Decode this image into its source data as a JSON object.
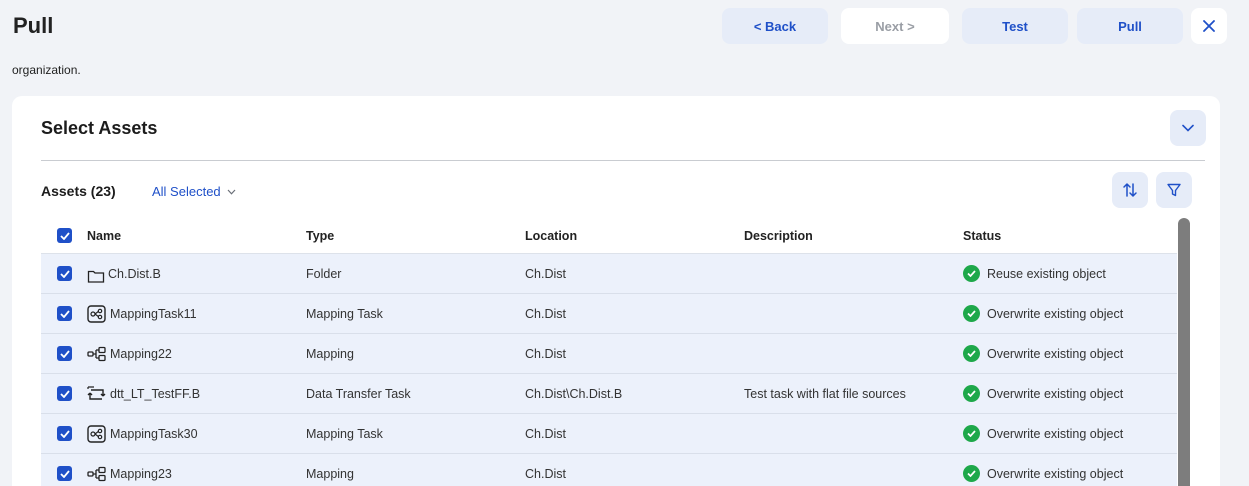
{
  "header": {
    "title": "Pull",
    "back_label": "< Back",
    "next_label": "Next >",
    "test_label": "Test",
    "pull_label": "Pull"
  },
  "org_text": "organization.",
  "panel": {
    "title": "Select Assets",
    "assets_label": "Assets (23)",
    "filter_label": "All Selected"
  },
  "table": {
    "columns": [
      "Name",
      "Type",
      "Location",
      "Description",
      "Status"
    ],
    "rows": [
      {
        "icon": "folder-icon",
        "name": "Ch.Dist.B",
        "type": "Folder",
        "location": "Ch.Dist",
        "description": "",
        "status": "Reuse existing object"
      },
      {
        "icon": "mapping-task-icon",
        "name": "MappingTask11",
        "type": "Mapping Task",
        "location": "Ch.Dist",
        "description": "",
        "status": "Overwrite existing object"
      },
      {
        "icon": "mapping-icon",
        "name": "Mapping22",
        "type": "Mapping",
        "location": "Ch.Dist",
        "description": "",
        "status": "Overwrite existing object"
      },
      {
        "icon": "data-transfer-task-icon",
        "name": "dtt_LT_TestFF.B",
        "type": "Data Transfer Task",
        "location": "Ch.Dist\\Ch.Dist.B",
        "description": "Test task with flat file sources",
        "status": "Overwrite existing object"
      },
      {
        "icon": "mapping-task-icon",
        "name": "MappingTask30",
        "type": "Mapping Task",
        "location": "Ch.Dist",
        "description": "",
        "status": "Overwrite existing object"
      },
      {
        "icon": "mapping-icon",
        "name": "Mapping23",
        "type": "Mapping",
        "location": "Ch.Dist",
        "description": "",
        "status": "Overwrite existing object"
      }
    ]
  },
  "colors": {
    "accent": "#1f50c8",
    "success": "#1ea84a",
    "row_bg": "#ecf1fb"
  }
}
